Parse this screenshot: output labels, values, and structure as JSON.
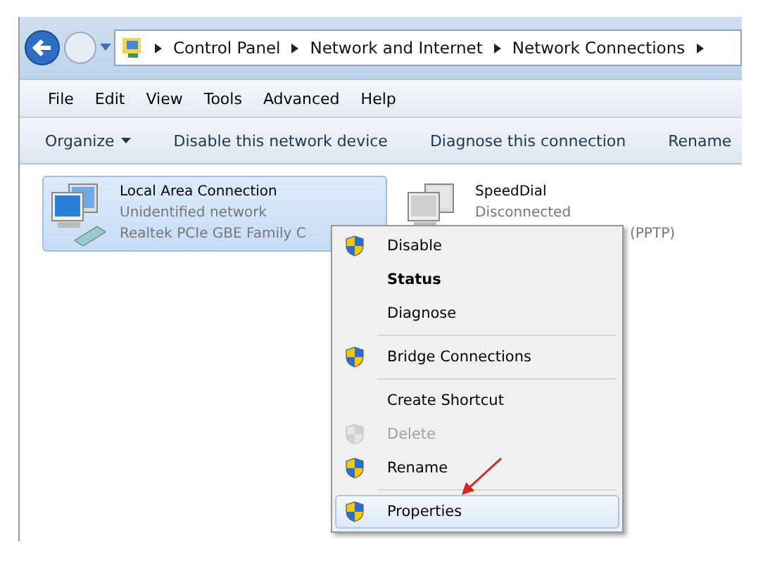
{
  "breadcrumb": [
    "Control Panel",
    "Network and Internet",
    "Network Connections"
  ],
  "menu_bar": [
    "File",
    "Edit",
    "View",
    "Tools",
    "Advanced",
    "Help"
  ],
  "toolbar": [
    {
      "label": "Organize",
      "dropdown": true
    },
    {
      "label": "Disable this network device",
      "dropdown": false
    },
    {
      "label": "Diagnose this connection",
      "dropdown": false
    },
    {
      "label": "Rename",
      "dropdown": false
    }
  ],
  "connections": [
    {
      "name": "Local Area Connection",
      "status": "Unidentified network",
      "device": "Realtek PCIe GBE Family C",
      "selected": true,
      "connected": true
    },
    {
      "name": "SpeedDial",
      "status": "Disconnected",
      "device": "(PPTP)",
      "selected": false,
      "connected": false
    }
  ],
  "context_menu": [
    {
      "kind": "item",
      "label": "Disable",
      "shield": true,
      "default": false,
      "disabled": false,
      "selected": false
    },
    {
      "kind": "item",
      "label": "Status",
      "shield": false,
      "default": true,
      "disabled": false,
      "selected": false
    },
    {
      "kind": "item",
      "label": "Diagnose",
      "shield": false,
      "default": false,
      "disabled": false,
      "selected": false
    },
    {
      "kind": "separator"
    },
    {
      "kind": "item",
      "label": "Bridge Connections",
      "shield": true,
      "default": false,
      "disabled": false,
      "selected": false
    },
    {
      "kind": "separator"
    },
    {
      "kind": "item",
      "label": "Create Shortcut",
      "shield": false,
      "default": false,
      "disabled": false,
      "selected": false
    },
    {
      "kind": "item",
      "label": "Delete",
      "shield": true,
      "default": false,
      "disabled": true,
      "selected": false
    },
    {
      "kind": "item",
      "label": "Rename",
      "shield": true,
      "default": false,
      "disabled": false,
      "selected": false
    },
    {
      "kind": "separator"
    },
    {
      "kind": "item",
      "label": "Properties",
      "shield": true,
      "default": false,
      "disabled": false,
      "selected": true
    }
  ]
}
